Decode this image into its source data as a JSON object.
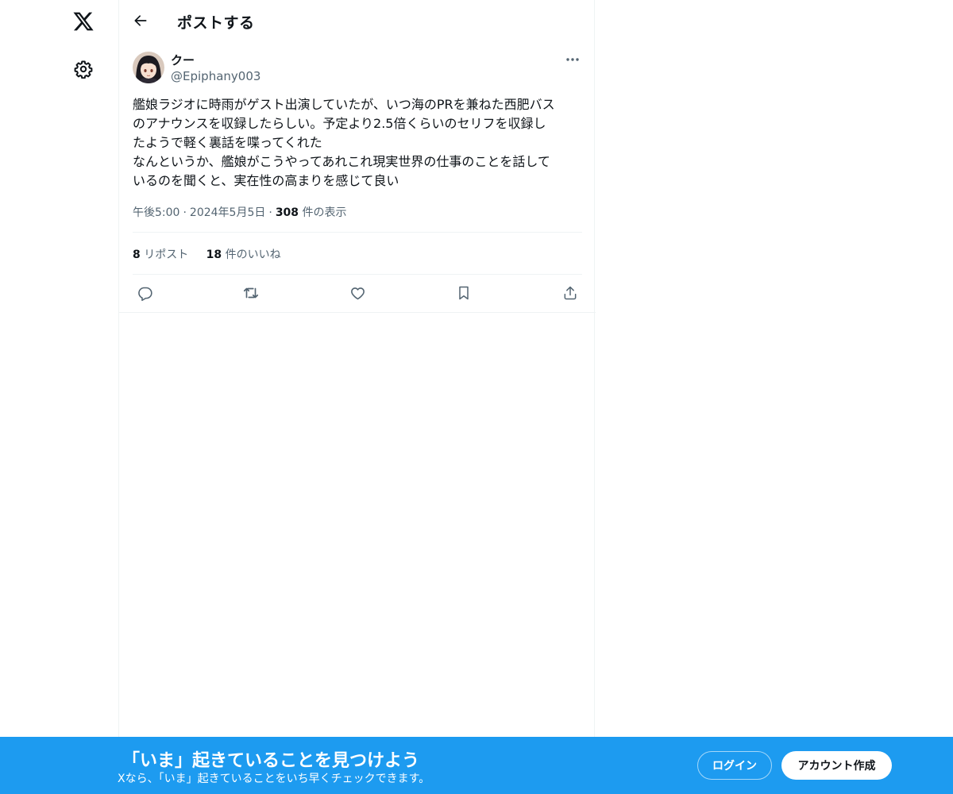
{
  "nav": {
    "logo_icon": "x-logo-icon",
    "settings_icon": "gear-icon"
  },
  "header": {
    "title": "ポストする",
    "back_icon": "arrow-left-icon"
  },
  "post": {
    "author_name": "クー",
    "author_handle": "@Epiphany003",
    "more_icon": "more-dots-icon",
    "text_lines": [
      "艦娘ラジオに時雨がゲスト出演していたが、いつ海のPRを兼ねた西肥バス",
      "のアナウンスを収録したらしい。予定より2.5倍くらいのセリフを収録し",
      "たようで軽く裏話を喋ってくれた",
      "なんというか、艦娘がこうやってあれこれ現実世界の仕事のことを話して",
      "いるのを聞くと、実在性の高まりを感じて良い"
    ],
    "time": "午後5:00",
    "date": "2024年5月5日",
    "views_count": "308",
    "views_label": "件の表示",
    "separator": "·",
    "reposts_count": "8",
    "reposts_label": "リポスト",
    "likes_count": "18",
    "likes_label": "件のいいね"
  },
  "actions": {
    "reply_icon": "reply-icon",
    "repost_icon": "repost-icon",
    "like_icon": "heart-icon",
    "bookmark_icon": "bookmark-icon",
    "share_icon": "share-icon"
  },
  "banner": {
    "title": "「いま」起きていることを見つけよう",
    "subtitle": "Xなら、「いま」起きていることをいち早くチェックできます。",
    "login_label": "ログイン",
    "signup_label": "アカウント作成"
  },
  "colors": {
    "accent": "#1d9bf0",
    "text": "#0f1419",
    "muted": "#536471",
    "border": "#eff3f4"
  }
}
